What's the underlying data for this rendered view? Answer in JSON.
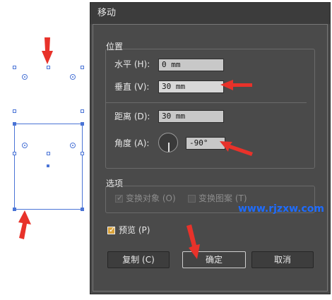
{
  "dialog": {
    "title": "移动",
    "position_group": {
      "title": "位置",
      "horizontal": {
        "label": "水平 (H):",
        "value": "0 mm"
      },
      "vertical": {
        "label": "垂直 (V):",
        "value": "30 mm"
      },
      "distance": {
        "label": "距离 (D):",
        "value": "30 mm"
      },
      "angle": {
        "label": "角度 (A):",
        "value": "-90°"
      }
    },
    "options_group": {
      "title": "选项",
      "transform_objects": {
        "label": "变换对象 (O)",
        "checked": true,
        "enabled": false
      },
      "transform_patterns": {
        "label": "变换图案 (T)",
        "checked": false,
        "enabled": false
      }
    },
    "preview": {
      "label": "预览 (P)",
      "checked": true
    },
    "buttons": {
      "copy": "复制 (C)",
      "ok": "确定",
      "cancel": "取消"
    }
  },
  "watermark": "www.rjzxw.com",
  "colors": {
    "dialog_bg": "#4a4a4a",
    "selection_blue": "#4a74d6",
    "arrow_red": "#e8322a",
    "watermark_blue": "#1e6cff"
  }
}
